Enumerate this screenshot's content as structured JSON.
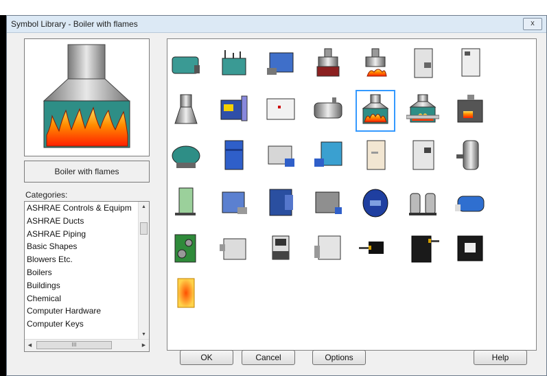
{
  "dialog": {
    "title": "Symbol Library - Boiler with flames",
    "close_label": "x"
  },
  "preview": {
    "symbol_name": "Boiler with flames"
  },
  "categories": {
    "label": "Categories:",
    "selected": "Boilers",
    "items": [
      "ASHRAE Controls & Equipm",
      "ASHRAE Ducts",
      "ASHRAE Piping",
      "Basic Shapes",
      "Blowers Etc.",
      "Boilers",
      "Buildings",
      "Chemical",
      "Computer Hardware",
      "Computer Keys"
    ],
    "scroll_thumb_label": "III"
  },
  "symbols": {
    "selected": "boiler-with-flames",
    "rows": [
      [
        "tank-boiler",
        "piped-boiler",
        "blue-boiler-unit",
        "stacked-burner",
        "flame-burner",
        "tall-gray-cabinet",
        "control-cabinet"
      ],
      [
        "chimney-hood",
        "firetube-blue-boiler",
        "white-panel-boiler",
        "horizontal-gray-boiler",
        "boiler-with-flames",
        "boiler-with-flames-and-pipe",
        "dark-furnace"
      ],
      [
        "teal-drum-boiler",
        "blue-tall-cabinet",
        "gray-box-boiler",
        "blue-modular-boiler",
        "beige-cabinet",
        "gray-panel-cabinet",
        "tall-cylinder-boiler"
      ],
      [
        "green-vertical-unit",
        "blue-box-unit",
        "blue-complex-unit",
        "gray-box-unit",
        "blue-round-unit",
        "twin-tank-unit",
        "blue-horizontal-tank"
      ],
      [
        "green-pump-skid",
        "gray-rect-unit",
        "small-black-boiler",
        "gray-boxed-unit",
        "black-inline-burner",
        "black-box-pipe",
        "black-framed-box"
      ],
      [
        "orange-heater-panel"
      ]
    ]
  },
  "buttons": {
    "ok": "OK",
    "cancel": "Cancel",
    "options": "Options",
    "help": "Help"
  },
  "colors": {
    "selection": "#3399ff",
    "flame": "#ff6600",
    "teal": "#2d8c8c"
  }
}
